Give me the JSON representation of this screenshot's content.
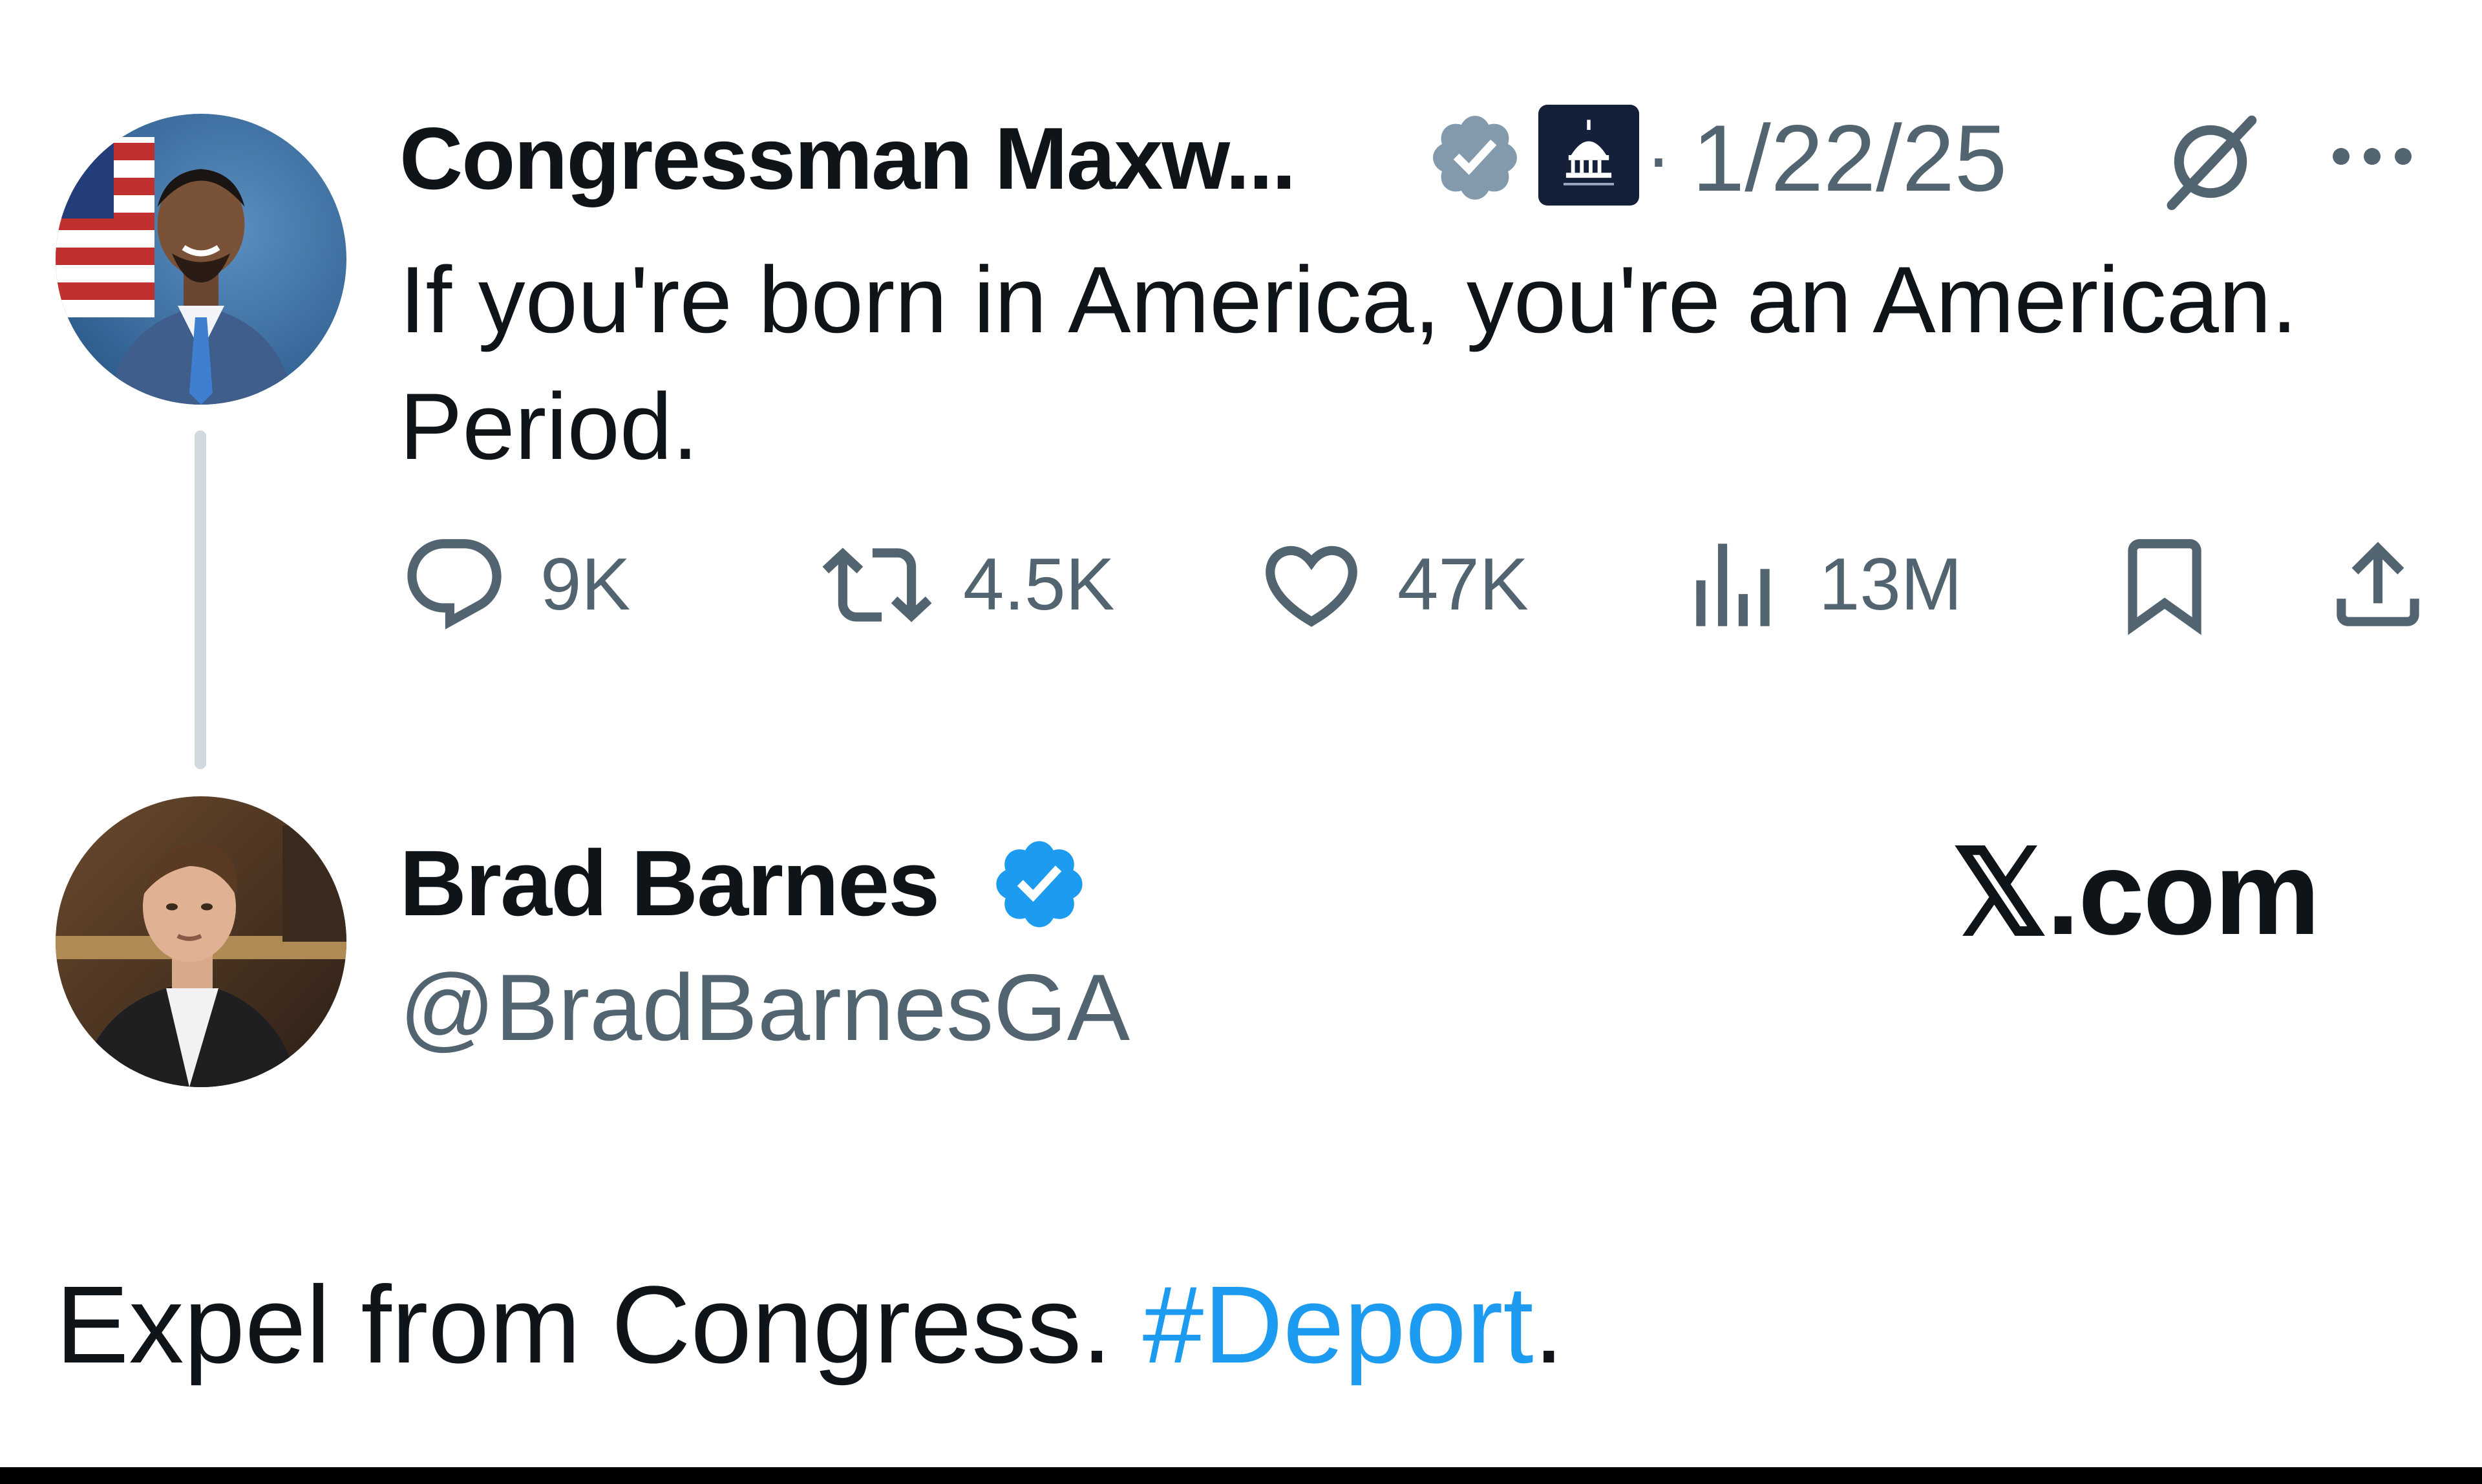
{
  "colors": {
    "text": "#0f1419",
    "secondary": "#536471",
    "link": "#1d9bf0",
    "verified_blue": "#1d9bf0",
    "verified_gray": "#829aab",
    "thread_line": "#cfd9de"
  },
  "quoted_post": {
    "author_name": "Congressman Maxw...",
    "verified_badge": "gray-verified-icon",
    "affiliation_badge": "capitol-dome-icon",
    "separator": "·",
    "date": "1/22/25",
    "text": "If you're born in America, you're an American.\nPeriod.",
    "actions": {
      "replies": "9K",
      "reposts": "4.5K",
      "likes": "47K",
      "views": "13M"
    },
    "icons": [
      "grok-icon",
      "more-icon",
      "reply-icon",
      "repost-icon",
      "like-icon",
      "views-icon",
      "bookmark-icon",
      "share-icon"
    ]
  },
  "reply_post": {
    "author_name": "Brad Barnes",
    "verified_badge": "blue-verified-icon",
    "handle": "@BradBarnesGA",
    "text_before": "Expel from Congress. ",
    "hashtag": "#Deport",
    "text_after": "."
  },
  "site_label": "𝕏.com"
}
